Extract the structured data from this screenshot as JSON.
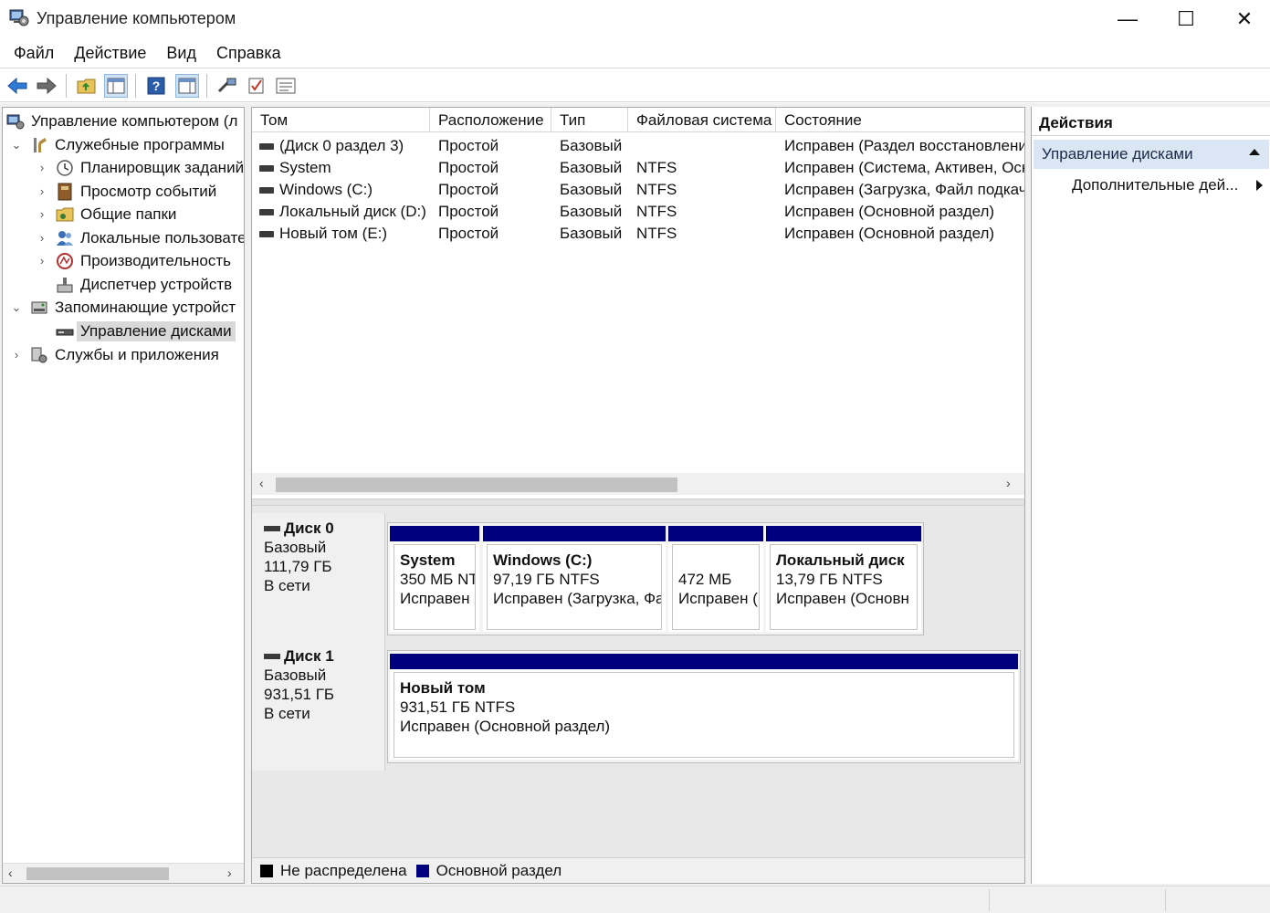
{
  "window": {
    "title": "Управление компьютером",
    "minimize_glyph": "—",
    "maximize_glyph": "☐",
    "close_glyph": "✕"
  },
  "menu": [
    "Файл",
    "Действие",
    "Вид",
    "Справка"
  ],
  "tree": {
    "root": "Управление компьютером (л",
    "system_tools": "Служебные программы",
    "task_scheduler": "Планировщик заданий",
    "event_viewer": "Просмотр событий",
    "shared_folders": "Общие папки",
    "local_users": "Локальные пользовате",
    "performance": "Производительность",
    "device_manager": "Диспетчер устройств",
    "storage": "Запоминающие устройст",
    "disk_management": "Управление дисками",
    "services_apps": "Службы и приложения"
  },
  "volumes": {
    "columns": [
      "Том",
      "Расположение",
      "Тип",
      "Файловая система",
      "Состояние"
    ],
    "rows": [
      {
        "name": "(Диск 0 раздел 3)",
        "layout": "Простой",
        "type": "Базовый",
        "fs": "",
        "status": "Исправен (Раздел восстановлени"
      },
      {
        "name": "System",
        "layout": "Простой",
        "type": "Базовый",
        "fs": "NTFS",
        "status": "Исправен (Система, Активен, Осн"
      },
      {
        "name": "Windows (C:)",
        "layout": "Простой",
        "type": "Базовый",
        "fs": "NTFS",
        "status": "Исправен (Загрузка, Файл подкач"
      },
      {
        "name": "Локальный диск (D:)",
        "layout": "Простой",
        "type": "Базовый",
        "fs": "NTFS",
        "status": "Исправен (Основной раздел)"
      },
      {
        "name": "Новый том (E:)",
        "layout": "Простой",
        "type": "Базовый",
        "fs": "NTFS",
        "status": "Исправен (Основной раздел)"
      }
    ]
  },
  "disks": [
    {
      "name": "Диск 0",
      "type": "Базовый",
      "size": "111,79 ГБ",
      "state": "В сети",
      "partitions": [
        {
          "name": "System",
          "size": "350 МБ NT",
          "status": "Исправен"
        },
        {
          "name": "Windows  (C:)",
          "size": "97,19 ГБ NTFS",
          "status": "Исправен (Загрузка, Фа"
        },
        {
          "name": "",
          "size": "472 МБ",
          "status": "Исправен ("
        },
        {
          "name": "Локальный диск",
          "size": "13,79 ГБ NTFS",
          "status": "Исправен (Основн"
        }
      ]
    },
    {
      "name": "Диск 1",
      "type": "Базовый",
      "size": "931,51 ГБ",
      "state": "В сети",
      "partitions": [
        {
          "name": "Новый том",
          "size": "931,51 ГБ NTFS",
          "status": "Исправен (Основной раздел)"
        }
      ]
    }
  ],
  "legend": {
    "unallocated": "Не распределена",
    "primary": "Основной раздел"
  },
  "actions": {
    "header": "Действия",
    "section": "Управление дисками",
    "more": "Дополнительные дей..."
  },
  "colors": {
    "primary_partition": "#00007f",
    "unallocated": "#000000",
    "selection": "#d9d9d9",
    "actions_section": "#dbe6f4"
  },
  "icons": [
    "computer-management-icon",
    "back-arrow-icon",
    "forward-arrow-icon",
    "up-folder-icon",
    "show-hide-tree-icon",
    "help-icon",
    "properties-icon",
    "connect-icon",
    "check-icon",
    "list-icon",
    "clock-icon",
    "event-viewer-icon",
    "shared-folder-icon",
    "users-icon",
    "performance-icon",
    "device-manager-icon",
    "storage-icon",
    "disk-management-icon",
    "services-icon",
    "volume-icon",
    "disk-icon"
  ]
}
